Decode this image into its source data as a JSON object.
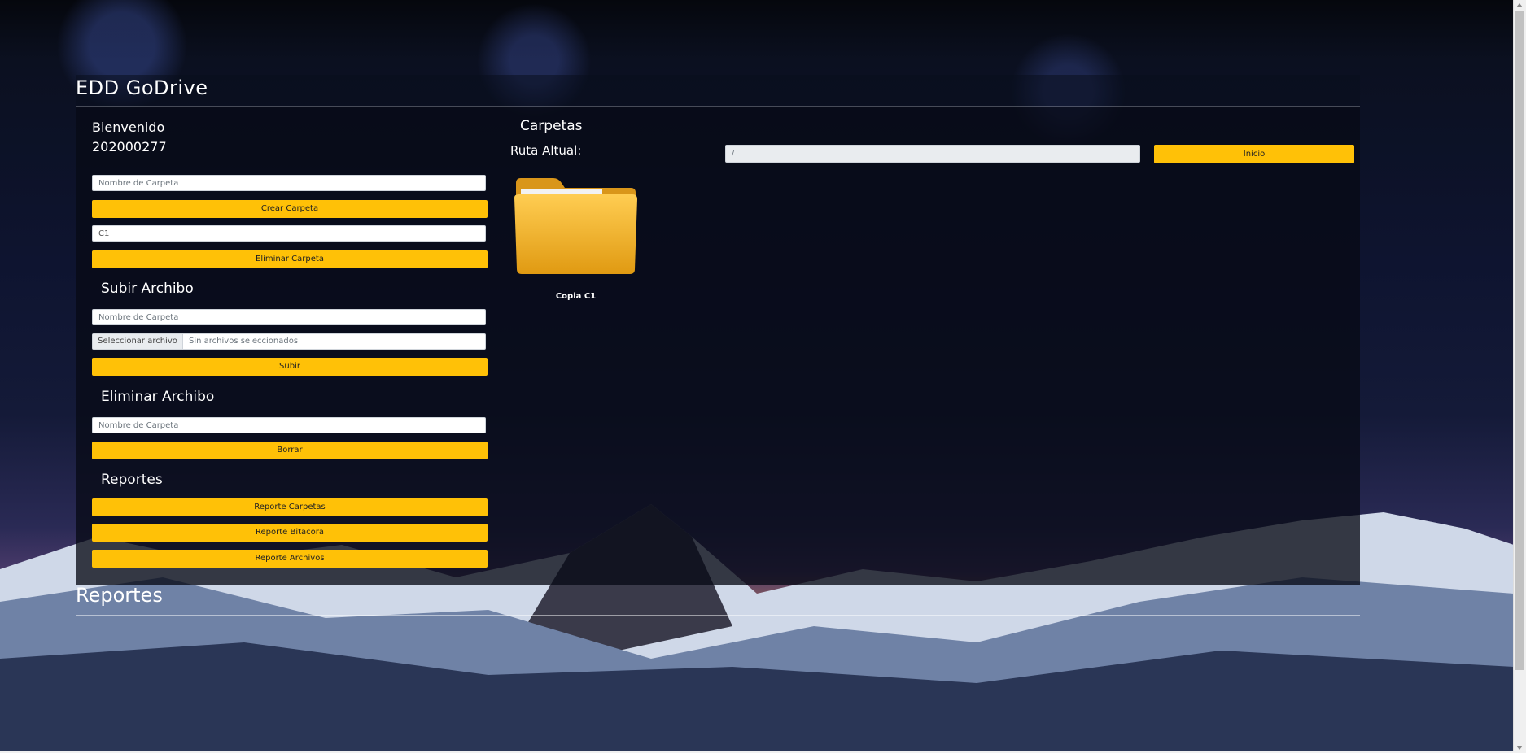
{
  "app": {
    "title": "EDD GoDrive"
  },
  "sidebar": {
    "welcome_label": "Bienvenido",
    "user_id": "202000277",
    "create_folder": {
      "placeholder": "Nombre de Carpeta",
      "button": "Crear Carpeta"
    },
    "delete_folder": {
      "value": "C1",
      "button": "Eliminar Carpeta"
    },
    "upload": {
      "title": "Subir Archibo",
      "placeholder": "Nombre de Carpeta",
      "file_button": "Seleccionar archivo",
      "file_status": "Sin archivos seleccionados",
      "button": "Subir"
    },
    "delete_file": {
      "title": "Eliminar Archibo",
      "placeholder": "Nombre de Carpeta",
      "button": "Borrar"
    },
    "reports": {
      "title": "Reportes",
      "buttons": [
        "Reporte Carpetas",
        "Reporte Bitacora",
        "Reporte Archivos"
      ]
    }
  },
  "main": {
    "title": "Carpetas",
    "path_label": "Ruta Altual:",
    "path_value": "/",
    "home_button": "Inicio",
    "folders": [
      {
        "name": "Copia C1",
        "icon": "folder-icon"
      }
    ]
  },
  "footer": {
    "title": "Reportes"
  },
  "colors": {
    "accent": "#ffc107",
    "panel": "#080a16"
  }
}
